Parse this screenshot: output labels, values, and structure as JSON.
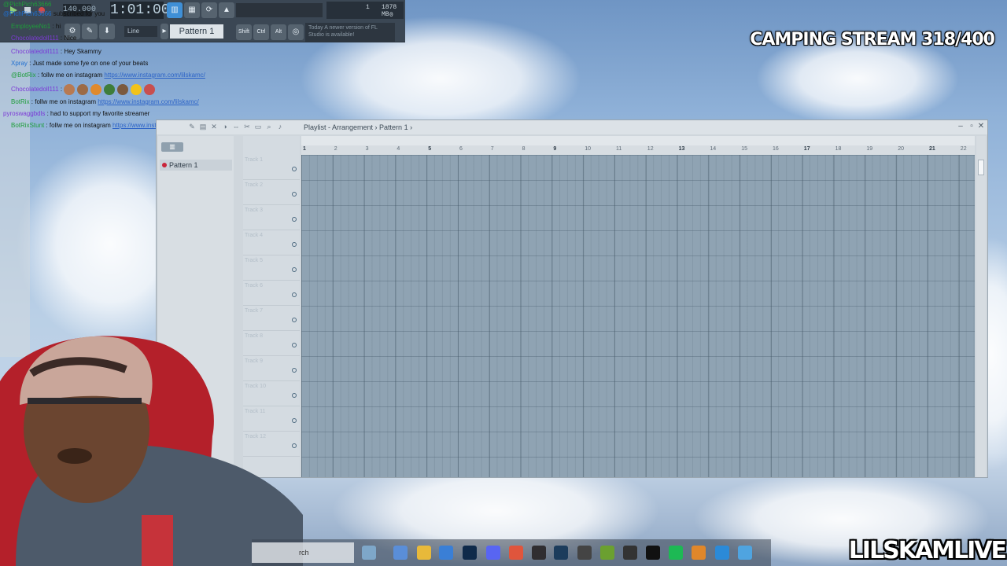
{
  "toolbar": {
    "tempo": "140.000",
    "time": "1:01:00",
    "cpu_top": "1",
    "cpu_mem": "1878 MB",
    "cpu_poly": "0",
    "line_mode": "Line",
    "pattern": "Pattern 1",
    "shift_label": "Shift",
    "ctrl_label": "Ctrl",
    "alt_label": "Alt",
    "hint_prefix": "Today",
    "hint_text": "A newer version of FL Studio is available!"
  },
  "chat": [
    {
      "user": "@PichPich63666",
      "text": "",
      "color": "g"
    },
    {
      "user": "@PichPich63666",
      "text": "subscribed for you",
      "color": "b"
    },
    {
      "user": "EmployeeNo1",
      "text": ": hi",
      "color": "g"
    },
    {
      "user": "Chocolatedoll111",
      "text": ": Nice",
      "color": "p"
    },
    {
      "user": "Chocolatedoll111",
      "text": ": Hey Skammy",
      "color": "p"
    },
    {
      "user": "Xpray",
      "text": ": Just made some fye on one of your beats",
      "color": "b"
    },
    {
      "user": "@BotRix",
      "text": ": follw me on instagram",
      "link": "https://www.instagram.com/lilskamc/",
      "color": "g"
    },
    {
      "user": "Chocolatedoll111",
      "text": ":",
      "color": "p"
    },
    {
      "user": "BotRix",
      "text": ": follw me on instagram",
      "link": "https://www.instagram.com/lilskamc/",
      "color": "g"
    },
    {
      "user": "pyroswaggbdls",
      "text": ": had to support my favorite streamer",
      "color": "p"
    },
    {
      "user": "BotRixStunt",
      "text": ": follw me on instagram",
      "link": "https://www.instagram.com/lilskamc/",
      "color": "g"
    }
  ],
  "overlay": {
    "title": "CAMPING STREAM 318/400",
    "brand": "LILSKAMLIVE"
  },
  "playlist": {
    "title": "Playlist - Arrangement",
    "pattern_crumb": "Pattern 1",
    "picker_item": "Pattern 1",
    "tracks": [
      "Track 1",
      "Track 2",
      "Track 3",
      "Track 4",
      "Track 5",
      "Track 6",
      "Track 7",
      "Track 8",
      "Track 9",
      "Track 10",
      "Track 11",
      "Track 12"
    ],
    "ruler": [
      "1",
      "2",
      "3",
      "4",
      "5",
      "6",
      "7",
      "8",
      "9",
      "10",
      "11",
      "12",
      "13",
      "14",
      "15",
      "16",
      "17",
      "18",
      "19",
      "20",
      "21",
      "22"
    ]
  },
  "taskbar": {
    "search": "rch"
  },
  "colors": {
    "accent": "#3f8fd6",
    "grid": "#8fa3b3",
    "sky": "#8fb1d8"
  }
}
